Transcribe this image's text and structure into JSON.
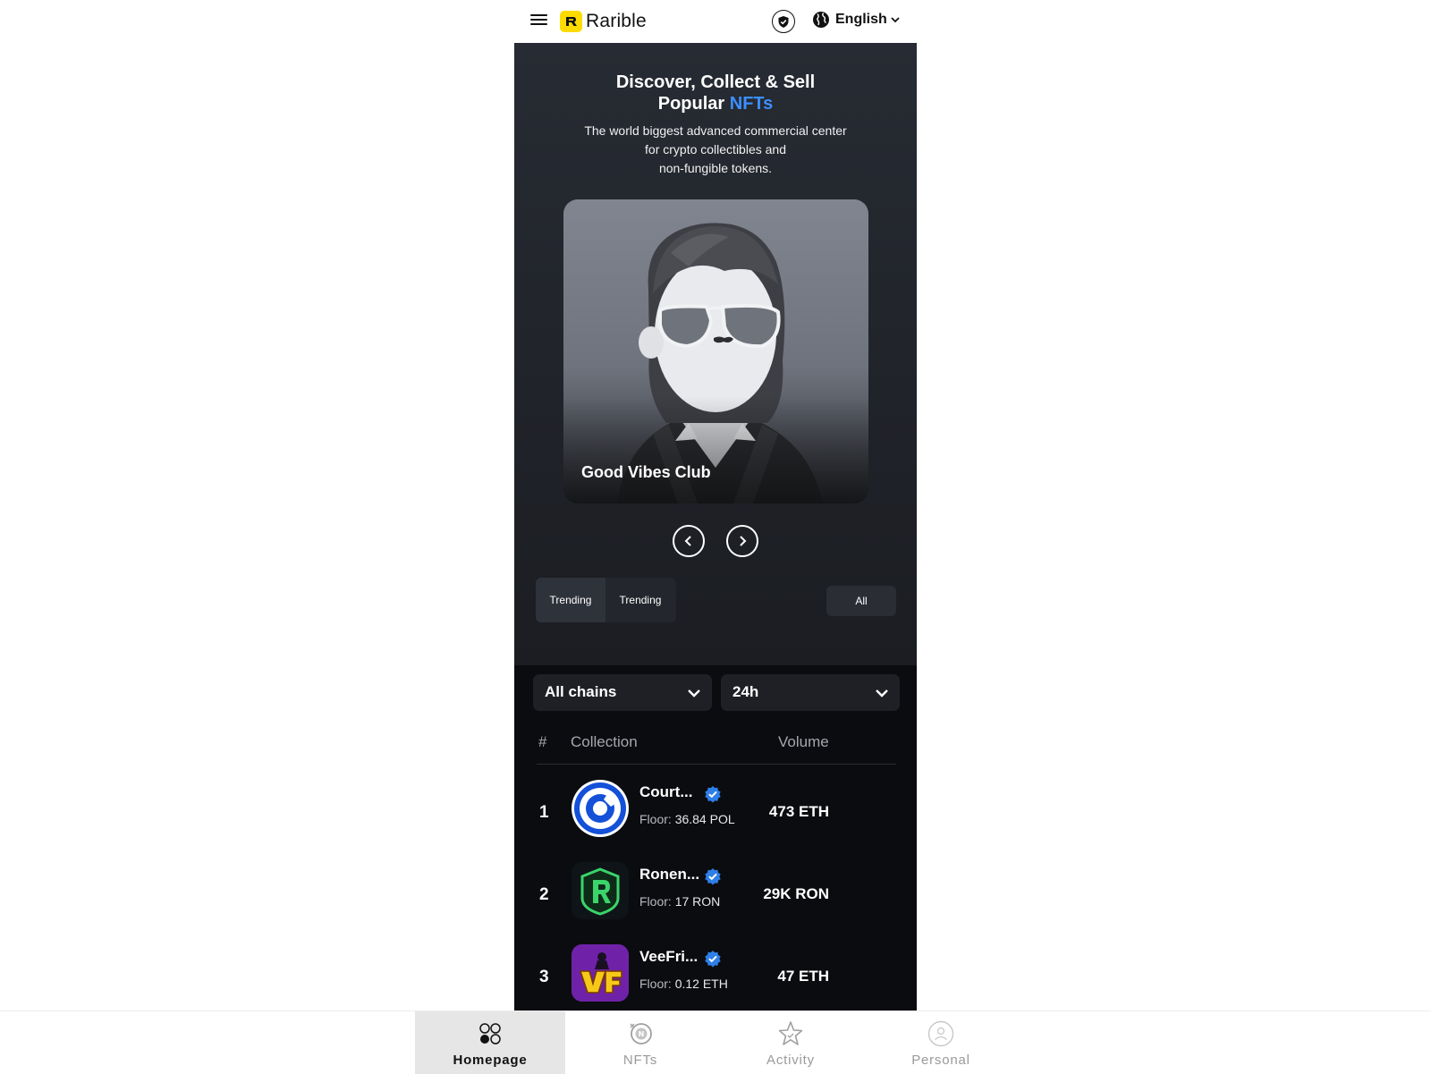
{
  "header": {
    "brand": "Rarible",
    "language": "English",
    "icons": {
      "menu": "hamburger-menu-icon",
      "shield": "shield-icon",
      "globe": "globe-icon",
      "chevron": "chevron-down-icon"
    }
  },
  "hero": {
    "title_line1": "Discover, Collect & Sell",
    "title_line2_prefix": "Popular ",
    "title_line2_accent": "NFTs",
    "subtitle_line1": "The world biggest advanced commercial center",
    "subtitle_line2": "for crypto collectibles and",
    "subtitle_line3": "non-fungible tokens.",
    "featured_title": "Good Vibes Club",
    "accent_color": "#3d8fff"
  },
  "tabs": {
    "items": [
      "Trending",
      "Trending"
    ],
    "active_index": 0,
    "filter_label": "All"
  },
  "ranking": {
    "chain_select": "All chains",
    "period_select": "24h",
    "columns": {
      "rank": "#",
      "collection": "Collection",
      "volume": "Volume"
    },
    "rows": [
      {
        "rank": "1",
        "name": "Court...",
        "floor_label": "Floor:",
        "floor_value": "36.84 POL",
        "volume": "473 ETH",
        "verified": true
      },
      {
        "rank": "2",
        "name": "Ronen...",
        "floor_label": "Floor:",
        "floor_value": "17 RON",
        "volume": "29K RON",
        "verified": true
      },
      {
        "rank": "3",
        "name": "VeeFri...",
        "floor_label": "Floor:",
        "floor_value": "0.12 ETH",
        "volume": "47 ETH",
        "verified": true
      }
    ]
  },
  "bottom_nav": {
    "items": [
      {
        "label": "Homepage",
        "icon": "homepage-icon"
      },
      {
        "label": "NFTs",
        "icon": "nfts-icon"
      },
      {
        "label": "Activity",
        "icon": "star-icon"
      },
      {
        "label": "Personal",
        "icon": "person-icon"
      }
    ],
    "active_index": 0
  }
}
